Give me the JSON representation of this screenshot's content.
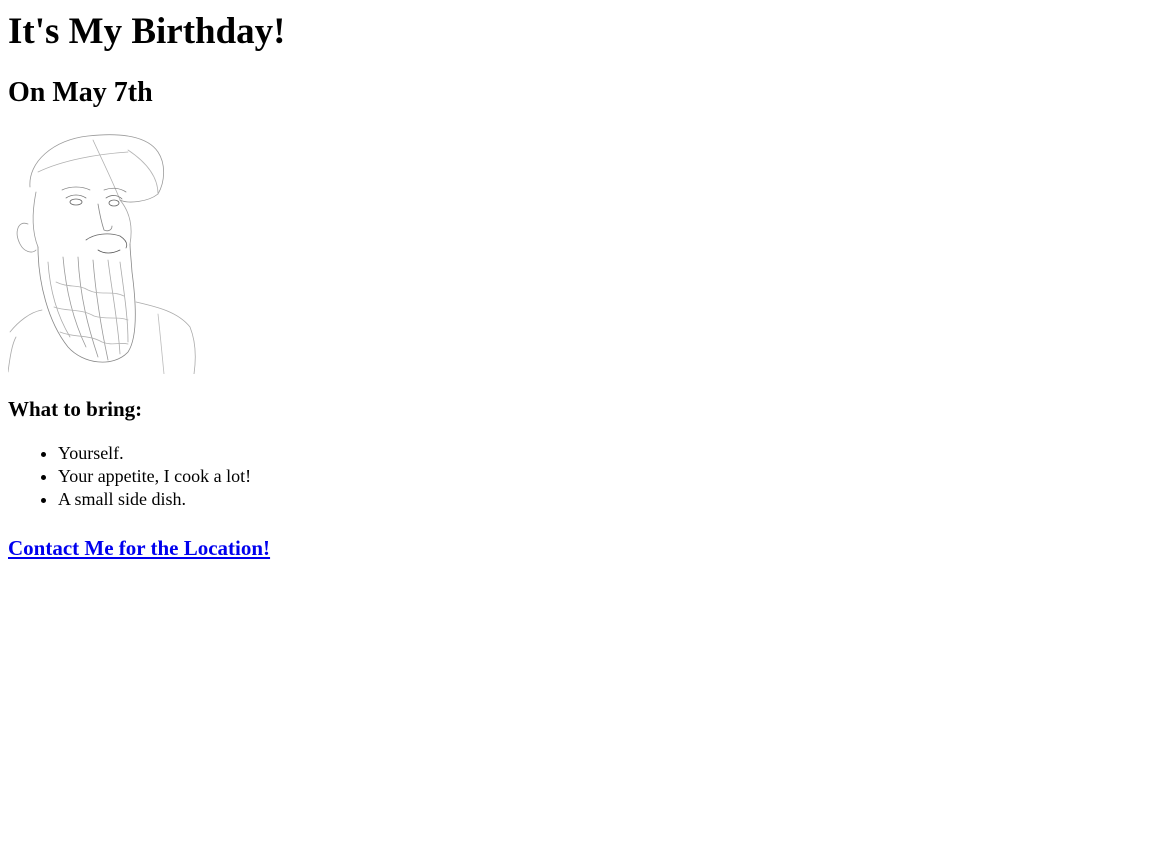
{
  "heading": {
    "title": "It's My Birthday!",
    "date": "On May 7th"
  },
  "portrait": {
    "icon": "bearded-man-sketch-portrait"
  },
  "bring": {
    "label": "What to bring:",
    "items": [
      "Yourself.",
      "Your appetite, I cook a lot!",
      "A small side dish."
    ]
  },
  "contact": {
    "link_text": "Contact Me for the Location!",
    "link_color": "#0000ee"
  }
}
